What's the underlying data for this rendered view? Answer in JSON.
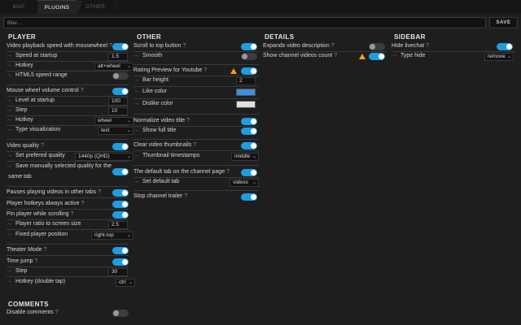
{
  "tabs": [
    "MAP",
    "PLUGINS",
    "OTHER"
  ],
  "filter": {
    "placeholder": "filter..."
  },
  "save_label": "SAVE",
  "player": {
    "heading": "PLAYER",
    "wheel_speed": "Video playback speed with mousewheel",
    "speed_startup": "Speed at startup",
    "speed_value": "1.5",
    "hotkey": "Hotkey",
    "hotkey_value": "alt+wheel",
    "html5_range": "HTML5 speed range",
    "volume": "Mouse wheel volume control",
    "level_startup": "Level at startup",
    "level_value": "100",
    "step": "Step",
    "step_value": "10",
    "vol_hotkey": "Hotkey",
    "vol_hotkey_value": "wheel",
    "type_vis": "Type visualization",
    "type_vis_value": "text",
    "quality": "Video quality",
    "pref_quality": "Set prefered quality",
    "pref_quality_value": "1440p (QHD)",
    "save_quality_1": "Save manually selected quality for the",
    "save_quality_2": "same tab",
    "pause_other": "Pauses playing videos in other tabs",
    "hotkeys_active": "Player hotkeys always active",
    "pin_scroll": "Pin player while scrolling",
    "ratio": "Player ratio to screen size",
    "ratio_value": "2.5",
    "fixed_pos": "Fixed player position",
    "fixed_pos_value": "right-top",
    "theater": "Theater Mode",
    "time_jump": "Time jump",
    "tj_step": "Step",
    "tj_step_value": "30",
    "tj_hotkey": "Hotkey (double tap)",
    "tj_hotkey_value": "ctrl"
  },
  "comments": {
    "heading": "COMMENTS",
    "disable": "Disable comments"
  },
  "other": {
    "heading": "OTHER",
    "scroll_top": "Scroll to top button",
    "smooth": "Smooth",
    "rating": "Rating Preview for Youtube",
    "bar_height": "Bar height",
    "bar_height_value": "2",
    "like_color": "Like color",
    "dislike_color": "Dislike color",
    "normalize": "Normalize video title",
    "full_title": "Show full title",
    "clear_thumbs": "Clear video thumbnails",
    "thumb_ts": "Thumbnail timestamps",
    "thumb_ts_value": "middle",
    "default_tab": "The default tab on the channel page",
    "set_default": "Set default tab",
    "set_default_value": "videos",
    "stop_trailer": "Stop channel trailer"
  },
  "details": {
    "heading": "DETAILS",
    "expand_desc": "Expands video description",
    "show_count": "Show channel videos count"
  },
  "sidebar": {
    "heading": "SIDEBAR",
    "hide_chat": "Hide livechat",
    "type_hide": "Type hide",
    "type_hide_value": "remove"
  },
  "colors": {
    "accent": "#1f9de0",
    "like": "#3d8fe0",
    "dislike": "#e0e0e0",
    "warning": "#f0a020"
  },
  "icons": [
    "help-icon",
    "arrow-right-icon",
    "chevron-down-icon",
    "warning-icon"
  ]
}
